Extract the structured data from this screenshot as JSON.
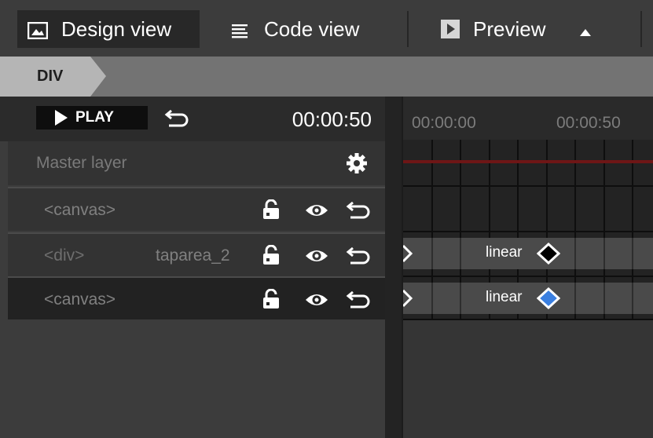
{
  "toolbar": {
    "design_view": "Design view",
    "code_view": "Code view",
    "preview": "Preview"
  },
  "breadcrumb": {
    "current": "DIV"
  },
  "timeline_controls": {
    "play_label": "PLAY",
    "current_time": "00:00:50"
  },
  "layers": {
    "master": "Master layer",
    "items": [
      {
        "tag": "<canvas>",
        "name": ""
      },
      {
        "tag": "<div>",
        "name": "taparea_2"
      },
      {
        "tag": "<canvas>",
        "name": ""
      }
    ]
  },
  "timeline": {
    "ruler": [
      "00:00:00",
      "00:00:50"
    ],
    "tracks": [
      {
        "easing": "linear",
        "keyframe_color": "#000000"
      },
      {
        "easing": "linear",
        "keyframe_color": "#3a7fe0"
      }
    ]
  },
  "colors": {
    "master_track_line": "#6e1616",
    "keyframe_selected": "#3a7fe0"
  },
  "icons": {
    "design": "image-icon",
    "code": "lines-icon",
    "preview": "play-box-icon",
    "layer_actions": [
      "lock-icon",
      "eye-icon",
      "undo-icon"
    ],
    "master": "gear-icon"
  }
}
